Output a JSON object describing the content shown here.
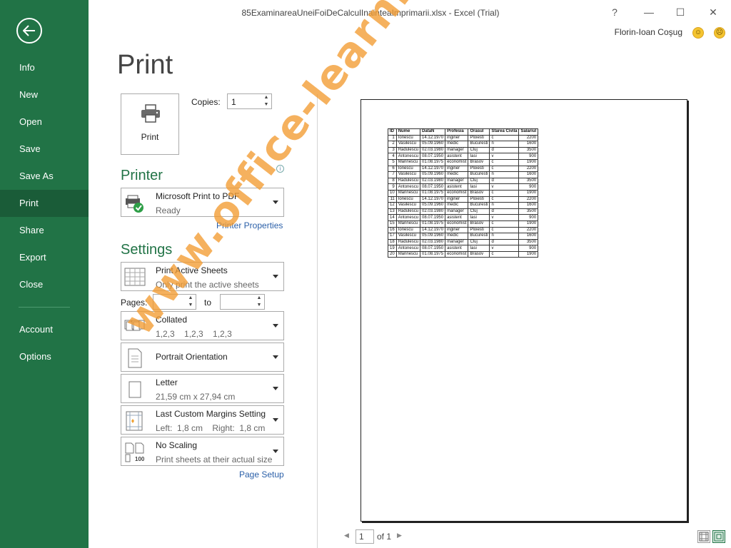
{
  "window": {
    "title": "85ExaminareaUneiFoiDeCalculInainteaImprimarii.xlsx - Excel (Trial)",
    "help": "?",
    "minimize": "—",
    "maximize": "☐",
    "close": "✕",
    "user": "Florin-Ioan Coşug"
  },
  "sidebar": {
    "items": [
      {
        "label": "Info"
      },
      {
        "label": "New"
      },
      {
        "label": "Open"
      },
      {
        "label": "Save"
      },
      {
        "label": "Save As"
      },
      {
        "label": "Print"
      },
      {
        "label": "Share"
      },
      {
        "label": "Export"
      },
      {
        "label": "Close"
      },
      {
        "label": "Account"
      },
      {
        "label": "Options"
      }
    ],
    "active": "Print"
  },
  "print": {
    "title": "Print",
    "button_label": "Print",
    "copies_label": "Copies:",
    "copies_value": "1"
  },
  "printer": {
    "heading": "Printer",
    "name": "Microsoft Print to PDF",
    "status": "Ready",
    "properties_link": "Printer Properties"
  },
  "settings": {
    "heading": "Settings",
    "what": {
      "title": "Print Active Sheets",
      "subtitle": "Only print the active sheets"
    },
    "pages_label": "Pages:",
    "to_label": "to",
    "collate": {
      "title": "Collated",
      "subtitle": "1,2,3    1,2,3    1,2,3"
    },
    "orientation": {
      "title": "Portrait Orientation"
    },
    "paper": {
      "title": "Letter",
      "subtitle": "21,59 cm x 27,94 cm"
    },
    "margins": {
      "title": "Last Custom Margins Setting",
      "subtitle": "Left:  1,8 cm    Right:  1,8 cm"
    },
    "scaling": {
      "title": "No Scaling",
      "subtitle": "Print sheets at their actual size",
      "icon_text": "100"
    },
    "page_setup_link": "Page Setup"
  },
  "preview": {
    "headers": [
      "ID",
      "Nume",
      "DataN",
      "Profesia",
      "Orasul",
      "Starea Civila",
      "Salariul"
    ],
    "rows": [
      [
        "1",
        "Ionescu",
        "14.12.1970",
        "inginer",
        "Ploiesti",
        "c",
        "2200"
      ],
      [
        "2",
        "Vasilescu",
        "05.09.1960",
        "medic",
        "Bucuresti",
        "n",
        "1600"
      ],
      [
        "3",
        "Radulescu",
        "02.03.1980",
        "manager",
        "Cluj",
        "d",
        "3500"
      ],
      [
        "4",
        "Antonescu",
        "08.07.1950",
        "asistent",
        "Iasi",
        "v",
        "900"
      ],
      [
        "5",
        "Marinescu",
        "01.08.1975",
        "economist",
        "Brasov",
        "c",
        "1900"
      ],
      [
        "6",
        "Ionescu",
        "14.12.1970",
        "inginer",
        "Ploiesti",
        "c",
        "2200"
      ],
      [
        "7",
        "Vasilescu",
        "05.09.1960",
        "medic",
        "Bucuresti",
        "n",
        "1600"
      ],
      [
        "8",
        "Radulescu",
        "02.03.1980",
        "manager",
        "Cluj",
        "d",
        "3500"
      ],
      [
        "9",
        "Antonescu",
        "08.07.1950",
        "asistent",
        "Iasi",
        "v",
        "900"
      ],
      [
        "10",
        "Marinescu",
        "01.08.1975",
        "economist",
        "Brasov",
        "c",
        "1900"
      ],
      [
        "11",
        "Ionescu",
        "14.12.1970",
        "inginer",
        "Ploiesti",
        "c",
        "2200"
      ],
      [
        "12",
        "Vasilescu",
        "05.09.1960",
        "medic",
        "Bucuresti",
        "n",
        "1600"
      ],
      [
        "13",
        "Radulescu",
        "02.03.1980",
        "manager",
        "Cluj",
        "d",
        "3500"
      ],
      [
        "14",
        "Antonescu",
        "08.07.1950",
        "asistent",
        "Iasi",
        "v",
        "900"
      ],
      [
        "15",
        "Marinescu",
        "01.08.1975",
        "economist",
        "Brasov",
        "c",
        "1900"
      ],
      [
        "16",
        "Ionescu",
        "14.12.1970",
        "inginer",
        "Ploiesti",
        "c",
        "2200"
      ],
      [
        "17",
        "Vasilescu",
        "05.09.1960",
        "medic",
        "Bucuresti",
        "n",
        "1600"
      ],
      [
        "18",
        "Radulescu",
        "02.03.1980",
        "manager",
        "Cluj",
        "d",
        "3500"
      ],
      [
        "19",
        "Antonescu",
        "08.07.1950",
        "asistent",
        "Iasi",
        "v",
        "900"
      ],
      [
        "20",
        "Marinescu",
        "01.08.1975",
        "economist",
        "Brasov",
        "c",
        "1900"
      ]
    ],
    "watermark": "www.office-learning.ro"
  },
  "pager": {
    "current": "1",
    "of_text": "of 1"
  },
  "colors": {
    "accent": "#217346",
    "link": "#2a5fa8",
    "watermark": "#f39c32"
  }
}
